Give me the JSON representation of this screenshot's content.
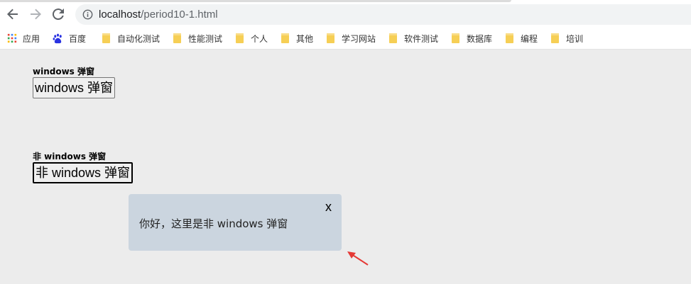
{
  "browser": {
    "url_host": "localhost",
    "url_path": "/period10-1.html"
  },
  "bookmarks": {
    "apps_label": "应用",
    "baidu_label": "百度",
    "folders": [
      "自动化测试",
      "性能测试",
      "个人",
      "其他",
      "学习网站",
      "软件测试",
      "数据库",
      "编程",
      "培训"
    ]
  },
  "page": {
    "section1": {
      "label": "windows 弹窗",
      "button_label": "windows 弹窗"
    },
    "section2": {
      "label": "非 windows 弹窗",
      "button_label": "非 windows 弹窗"
    },
    "popup": {
      "close_label": "x",
      "message": "你好，这里是非 windows 弹窗"
    }
  },
  "colors": {
    "page_background": "#ececec",
    "popup_background": "#cbd5df",
    "annotation_arrow": "#e53935"
  }
}
